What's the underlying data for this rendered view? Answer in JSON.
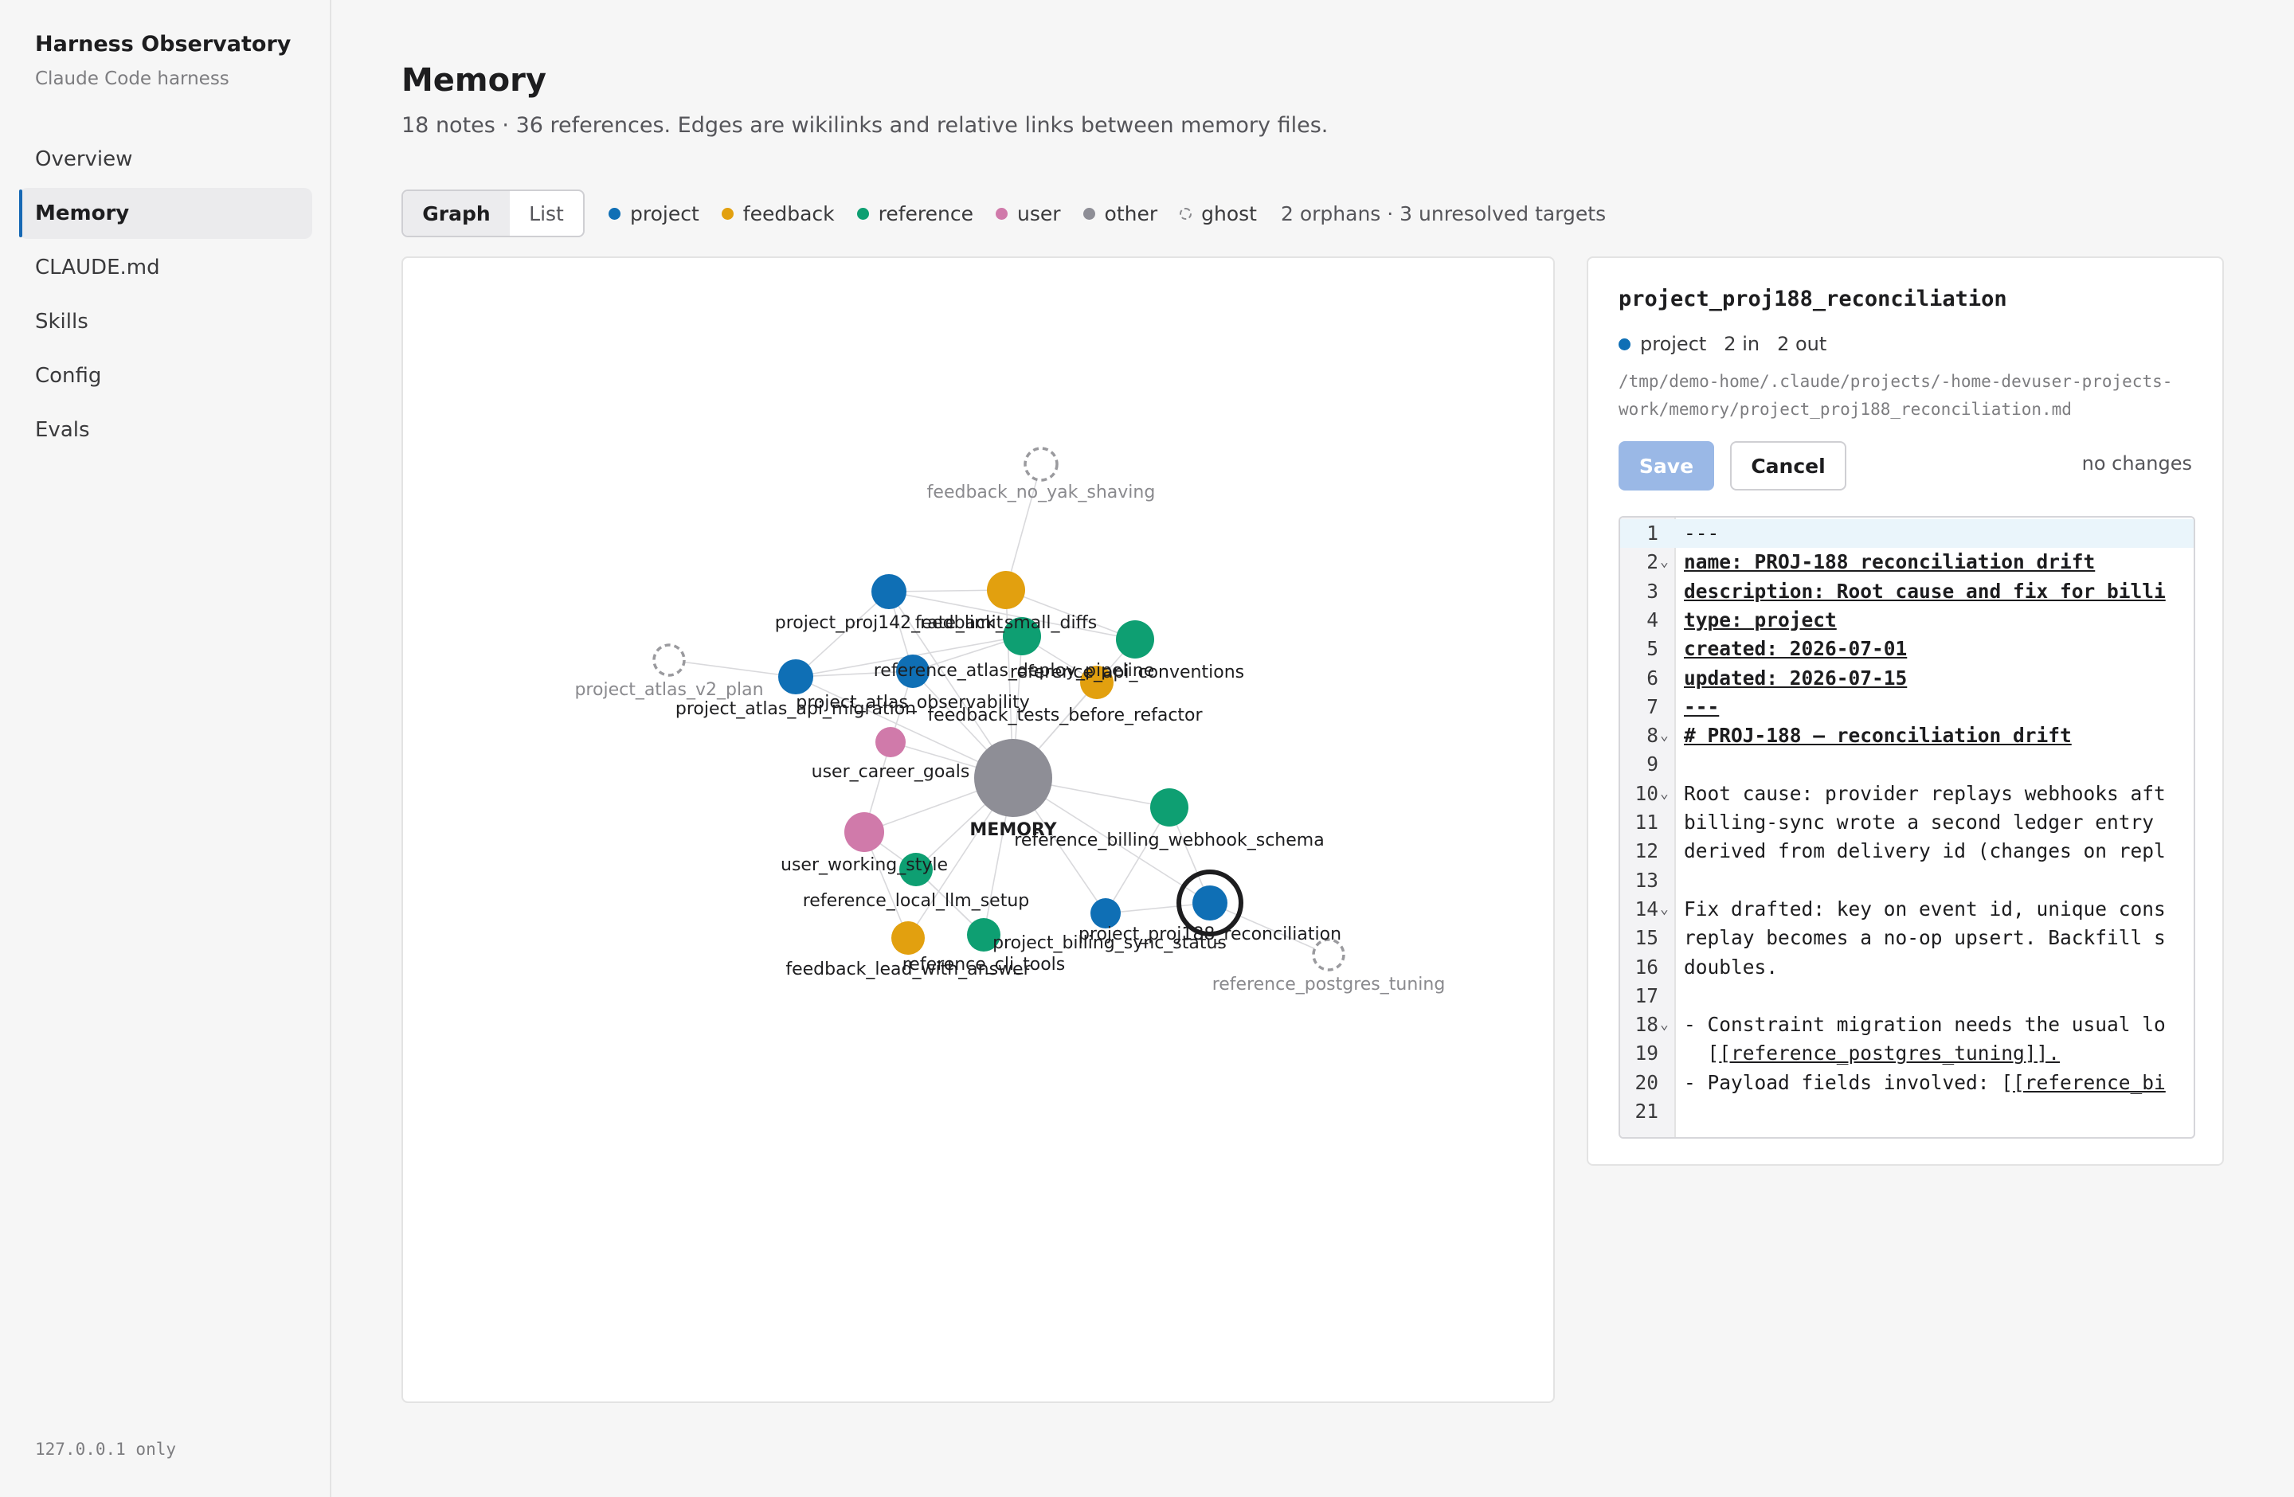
{
  "sidebar": {
    "title": "Harness Observatory",
    "subtitle": "Claude Code harness",
    "items": [
      {
        "label": "Overview",
        "active": false
      },
      {
        "label": "Memory",
        "active": true
      },
      {
        "label": "CLAUDE.md",
        "active": false
      },
      {
        "label": "Skills",
        "active": false
      },
      {
        "label": "Config",
        "active": false
      },
      {
        "label": "Evals",
        "active": false
      }
    ],
    "footer": "127.0.0.1 only"
  },
  "header": {
    "title": "Memory",
    "subtitle": "18 notes · 36 references. Edges are wikilinks and relative links between memory files."
  },
  "view_toggle": {
    "graph_label": "Graph",
    "list_label": "List",
    "active": "Graph"
  },
  "legend": {
    "items": [
      {
        "label": "project",
        "color": "#0f6fb5"
      },
      {
        "label": "feedback",
        "color": "#e2a00f"
      },
      {
        "label": "reference",
        "color": "#0e9f72"
      },
      {
        "label": "user",
        "color": "#d07aaa"
      },
      {
        "label": "other",
        "color": "#8e8e96"
      },
      {
        "label": "ghost",
        "color": "ghost"
      }
    ],
    "summary": "2 orphans · 3 unresolved targets"
  },
  "graph": {
    "colors": {
      "project": "#0f6fb5",
      "feedback": "#e2a00f",
      "reference": "#0e9f72",
      "user": "#d07aaa",
      "other": "#8e8e96"
    },
    "nodes": [
      {
        "id": "feedback_no_yak_shaving",
        "label": "feedback_no_yak_shaving",
        "type": "ghost"
      },
      {
        "id": "project_proj142_rate_limit",
        "label": "project_proj142_rate_limit",
        "type": "project"
      },
      {
        "id": "feedback_small_diffs",
        "label": "feedback_small_diffs",
        "type": "feedback"
      },
      {
        "id": "reference_atlas_deploy_pipeline",
        "label": "reference_atlas_deploy_pipeline",
        "type": "reference"
      },
      {
        "id": "reference_api_conventions",
        "label": "reference_api_conventions",
        "type": "reference"
      },
      {
        "id": "project_atlas_v2_plan",
        "label": "project_atlas_v2_plan",
        "type": "ghost"
      },
      {
        "id": "project_atlas_observability",
        "label": "project_atlas_observability",
        "type": "project"
      },
      {
        "id": "project_atlas_api_migration",
        "label": "project_atlas_api_migration",
        "type": "project"
      },
      {
        "id": "feedback_tests_before_refactor",
        "label": "feedback_tests_before_refactor",
        "type": "feedback"
      },
      {
        "id": "user_career_goals",
        "label": "user_career_goals",
        "type": "user"
      },
      {
        "id": "MEMORY",
        "label": "MEMORY",
        "type": "other"
      },
      {
        "id": "reference_billing_webhook_schema",
        "label": "reference_billing_webhook_schema",
        "type": "reference"
      },
      {
        "id": "user_working_style",
        "label": "user_working_style",
        "type": "user"
      },
      {
        "id": "reference_local_llm_setup",
        "label": "reference_local_llm_setup",
        "type": "reference"
      },
      {
        "id": "project_proj188_reconciliation",
        "label": "project_proj188_reconciliation",
        "type": "project",
        "selected": true
      },
      {
        "id": "project_billing_sync_status",
        "label": "project_billing_sync_status",
        "type": "project"
      },
      {
        "id": "reference_postgres_tuning",
        "label": "reference_postgres_tuning",
        "type": "ghost"
      },
      {
        "id": "feedback_lead_with_answer",
        "label": "feedback_lead_with_answer",
        "type": "feedback"
      },
      {
        "id": "reference_cli_tools",
        "label": "reference_cli_tools",
        "type": "reference"
      }
    ]
  },
  "detail": {
    "title": "project_proj188_reconciliation",
    "type": "project",
    "in_count": "2 in",
    "out_count": "2 out",
    "path": "/tmp/demo-home/.claude/projects/-home-devuser-projects-work/memory/project_proj188_reconciliation.md",
    "save_label": "Save",
    "cancel_label": "Cancel",
    "status": "no changes",
    "lines": [
      {
        "n": "1",
        "text": "---",
        "style": "plain",
        "fold": false
      },
      {
        "n": "2",
        "text": "name: PROJ-188 reconciliation drift",
        "style": "fm",
        "fold": true
      },
      {
        "n": "3",
        "text": "description: Root cause and fix for billi",
        "style": "fm",
        "fold": false
      },
      {
        "n": "4",
        "text": "type: project",
        "style": "fm",
        "fold": false
      },
      {
        "n": "5",
        "text": "created: 2026-07-01",
        "style": "fm",
        "fold": false
      },
      {
        "n": "6",
        "text": "updated: 2026-07-15",
        "style": "fm",
        "fold": false
      },
      {
        "n": "7",
        "text": "---",
        "style": "fm",
        "fold": false
      },
      {
        "n": "8",
        "text": "# PROJ-188 — reconciliation drift",
        "style": "fm",
        "fold": true
      },
      {
        "n": "9",
        "text": "",
        "style": "plain",
        "fold": false
      },
      {
        "n": "10",
        "text": "Root cause: provider replays webhooks aft",
        "style": "plain",
        "fold": true
      },
      {
        "n": "11",
        "text": "billing-sync wrote a second ledger entry",
        "style": "plain",
        "fold": false
      },
      {
        "n": "12",
        "text": "derived from delivery id (changes on repl",
        "style": "plain",
        "fold": false
      },
      {
        "n": "13",
        "text": "",
        "style": "plain",
        "fold": false
      },
      {
        "n": "14",
        "text": "Fix drafted: key on event id, unique cons",
        "style": "plain",
        "fold": true
      },
      {
        "n": "15",
        "text": "replay becomes a no-op upsert. Backfill s",
        "style": "plain",
        "fold": false
      },
      {
        "n": "16",
        "text": "doubles.",
        "style": "plain",
        "fold": false
      },
      {
        "n": "17",
        "text": "",
        "style": "plain",
        "fold": false
      },
      {
        "n": "18",
        "text": "- Constraint migration needs the usual lo",
        "style": "plain",
        "fold": true
      },
      {
        "n": "19",
        "text": "  [[reference_postgres_tuning]].",
        "style": "wikilink",
        "fold": false
      },
      {
        "n": "20",
        "text": "- Payload fields involved: [[reference_bi",
        "style": "wikilink",
        "fold": false
      },
      {
        "n": "21",
        "text": "",
        "style": "plain",
        "fold": false
      }
    ]
  }
}
